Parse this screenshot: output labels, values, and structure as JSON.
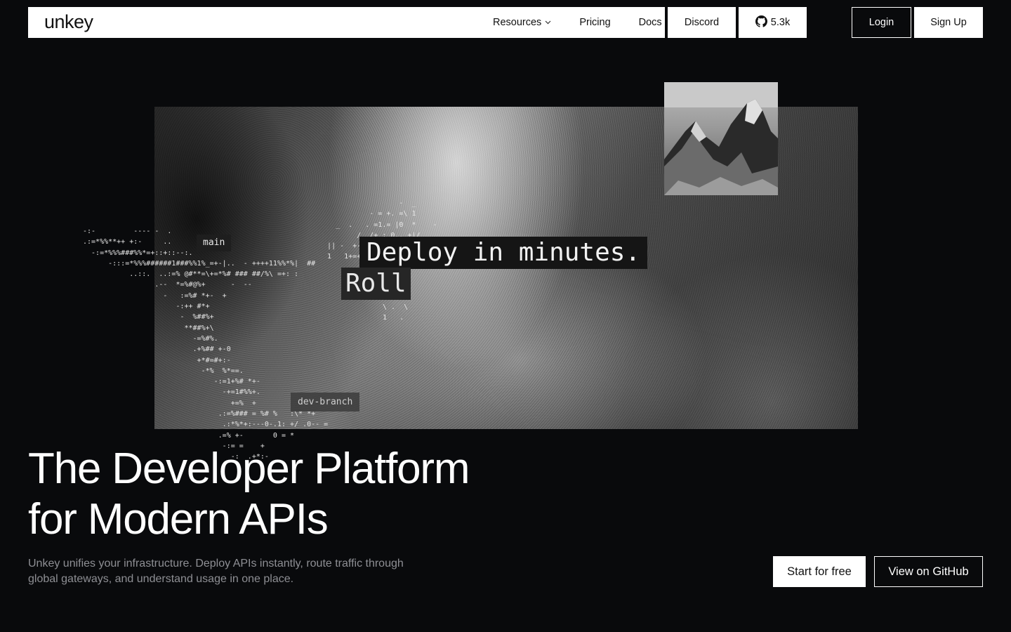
{
  "nav": {
    "logo": "unkey",
    "links": [
      {
        "label": "Resources",
        "has_dropdown": true
      },
      {
        "label": "Pricing"
      },
      {
        "label": "Docs"
      }
    ],
    "discord_label": "Discord",
    "github_stars": "5.3k",
    "login_label": "Login",
    "signup_label": "Sign Up"
  },
  "hero": {
    "tags": {
      "main": "main",
      "dev_branch": "dev-branch",
      "deploy": "Deploy in minutes.",
      "roll": "Roll"
    },
    "headline_line1": "The Developer Platform",
    "headline_line2": "for Modern APIs",
    "subtext": "Unkey unifies your infrastructure. Deploy APIs instantly, route traffic through global gateways, and understand usage in one place.",
    "cta_primary": "Start for free",
    "cta_secondary": "View on GitHub"
  },
  "colors": {
    "background": "#090a0c",
    "surface": "#ffffff",
    "subtext": "#8e8f94"
  },
  "icons": [
    "github-icon",
    "chevron-down-icon"
  ]
}
